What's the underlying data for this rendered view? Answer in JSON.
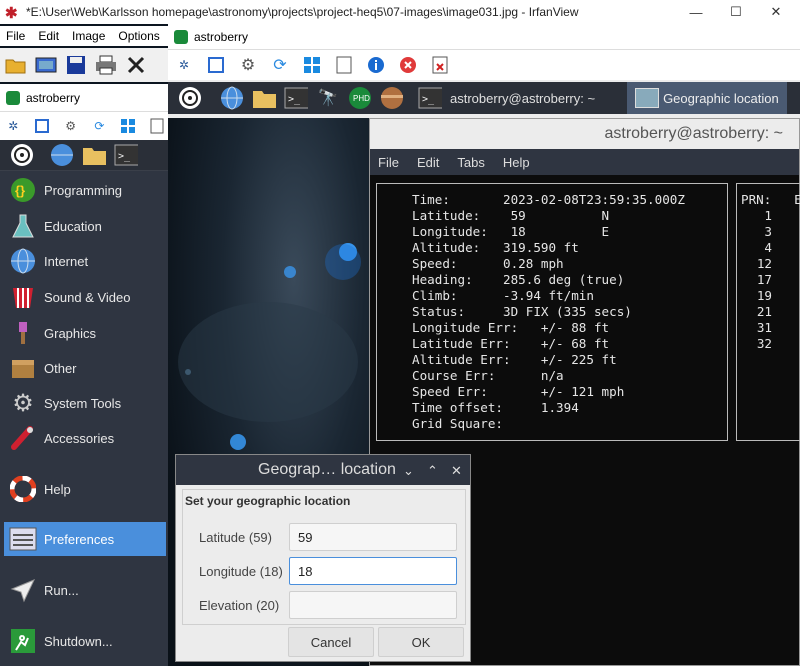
{
  "irfanview": {
    "title": "*E:\\User\\Web\\Karlsson homepage\\astronomy\\projects\\project-heq5\\07-images\\image031.jpg - IrfanView",
    "menu": [
      "File",
      "Edit",
      "Image",
      "Options"
    ]
  },
  "pi_window_top": {
    "title": "astroberry"
  },
  "pi_window_left": {
    "title": "astroberry"
  },
  "taskbar": {
    "terminal_label": "astroberry@astroberry: ~",
    "geo_label": "Geographic location"
  },
  "app_menu": {
    "items": [
      {
        "label": "Programming",
        "icon": "programming-icon"
      },
      {
        "label": "Education",
        "icon": "education-icon"
      },
      {
        "label": "Internet",
        "icon": "internet-icon"
      },
      {
        "label": "Sound & Video",
        "icon": "sound-video-icon"
      },
      {
        "label": "Graphics",
        "icon": "graphics-icon"
      },
      {
        "label": "Other",
        "icon": "other-icon"
      },
      {
        "label": "System Tools",
        "icon": "system-tools-icon"
      },
      {
        "label": "Accessories",
        "icon": "accessories-icon"
      },
      {
        "label": "Help",
        "icon": "help-icon"
      },
      {
        "label": "Preferences",
        "icon": "preferences-icon"
      },
      {
        "label": "Run...",
        "icon": "run-icon"
      },
      {
        "label": "Shutdown...",
        "icon": "shutdown-icon"
      }
    ]
  },
  "terminal": {
    "title": "astroberry@astroberry: ~",
    "menu": [
      "File",
      "Edit",
      "Tabs",
      "Help"
    ],
    "gps_lines": [
      "Time:       2023-02-08T23:59:35.000Z",
      "Latitude:    59          N",
      "Longitude:   18          E",
      "Altitude:   319.590 ft",
      "Speed:      0.28 mph",
      "Heading:    285.6 deg (true)",
      "Climb:      -3.94 ft/min",
      "Status:     3D FIX (335 secs)",
      "Longitude Err:   +/- 88 ft",
      "Latitude Err:    +/- 68 ft",
      "Altitude Err:    +/- 225 ft",
      "Course Err:      n/a",
      "Speed Err:       +/- 121 mph",
      "Time offset:     1.394",
      "Grid Square:"
    ],
    "prn_header": "PRN:   E",
    "prn_values": [
      "1",
      "3",
      "4",
      "12",
      "17",
      "19",
      "21",
      "31",
      "32"
    ]
  },
  "dialog": {
    "title": "Geograp… location",
    "group_title": "Set your geographic location",
    "latitude_label": "Latitude (59)",
    "latitude_value": "59",
    "longitude_label": "Longitude (18)",
    "longitude_value": "18",
    "elevation_label": "Elevation (20)",
    "elevation_value": "",
    "cancel": "Cancel",
    "ok": "OK"
  }
}
